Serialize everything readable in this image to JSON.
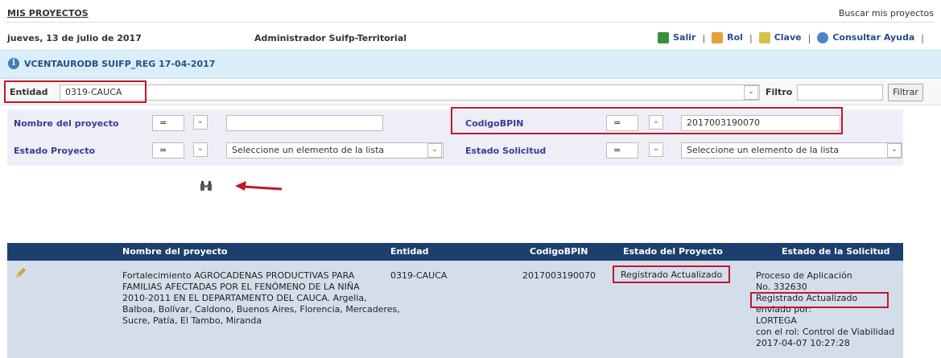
{
  "header": {
    "title": "MIS PROYECTOS",
    "search_link": "Buscar mis proyectos",
    "date": "jueves, 13 de julio de 2017",
    "role": "Administrador Suifp-Territorial"
  },
  "nav": {
    "items": [
      {
        "label": "Salir",
        "icon": "exit-icon"
      },
      {
        "label": "Rol",
        "icon": "users-icon"
      },
      {
        "label": "Clave",
        "icon": "key-icon"
      },
      {
        "label": "Consultar Ayuda",
        "icon": "help-icon"
      }
    ],
    "separator": "|"
  },
  "banner": {
    "info_glyph": "i",
    "text": "VCENTAURODB SUIFP_REG 17-04-2017"
  },
  "entidad": {
    "label": "Entidad",
    "value": "0319-CAUCA",
    "filtro_label": "Filtro",
    "filtro_value": "",
    "filter_button": "Filtrar"
  },
  "filters": {
    "nombre_label": "Nombre del proyecto",
    "nombre_op": "=",
    "nombre_value": "",
    "estado_proyecto_label": "Estado Proyecto",
    "estado_proyecto_op": "=",
    "estado_proyecto_value": "Seleccione un elemento de la lista",
    "codigo_label": "CodigoBPIN",
    "codigo_op": "=",
    "codigo_value": "2017003190070",
    "estado_solicitud_label": "Estado Solicitud",
    "estado_solicitud_op": "=",
    "estado_solicitud_value": "Seleccione un elemento de la lista"
  },
  "table": {
    "columns": [
      "Nombre del proyecto",
      "Entidad",
      "CodigoBPIN",
      "Estado del Proyecto",
      "Estado de la Solicitud"
    ],
    "rows": [
      {
        "nombre_lines": [
          "Fortalecimiento AGROCADENAS PRODUCTIVAS PARA",
          "FAMILIAS AFECTADAS POR EL FENÓMENO DE LA NIÑA",
          "2010-2011 EN EL DEPARTAMENTO DEL CAUCA. Argelia,",
          "Balboa, Bolívar, Caldono, Buenos Aires, Florencia, Mercaderes,",
          "Sucre, Patía, El Tambo, Miranda"
        ],
        "entidad": "0319-CAUCA",
        "codigo": "2017003190070",
        "estado_proyecto": "Registrado Actualizado",
        "solicitud_lines": [
          "Proceso de Aplicación",
          "No. 332630",
          "Registrado Actualizado",
          "enviado por:",
          "LORTEGA",
          "con el rol: Control de Viabilidad",
          "2017-04-07 10:27:28"
        ]
      }
    ]
  },
  "colors": {
    "header_navy": "#1d3f6e",
    "row_bg": "#d4ddea",
    "banner_bg": "#d9eef8",
    "highlight_red": "#c0182c",
    "filter_bg": "#eeeef7"
  }
}
